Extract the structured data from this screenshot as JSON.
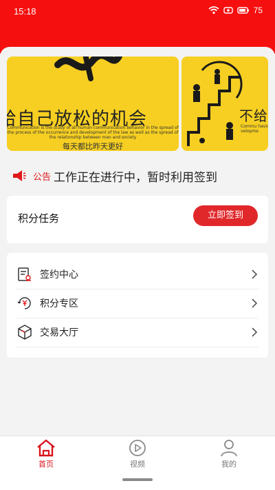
{
  "status_bar": {
    "time": "15:18",
    "battery": "75"
  },
  "banner": {
    "slide1": {
      "headline": "给自己放松的机会",
      "english": "Communication is the study of all human communication behavior in the spread of the process of the occurrence and development of the law as well as the spread of the relationship between man and society",
      "subline": "每天都比昨天更好"
    },
    "slide2": {
      "headline": "不给",
      "english": "Commu havior and velopme"
    }
  },
  "notice": {
    "tag": "公告",
    "text": "工作正在进行中，暂时利用签到"
  },
  "task": {
    "title": "积分任务",
    "button": "立即签到"
  },
  "menu": [
    {
      "label": "签约中心",
      "icon": "contract-icon"
    },
    {
      "label": "积分专区",
      "icon": "points-icon"
    },
    {
      "label": "交易大厅",
      "icon": "trade-box-icon"
    }
  ],
  "tabbar": {
    "tabs": [
      {
        "label": "首页",
        "icon": "home-icon",
        "active": true
      },
      {
        "label": "视频",
        "icon": "play-icon",
        "active": false
      },
      {
        "label": "我的",
        "icon": "user-icon",
        "active": false
      }
    ]
  },
  "colors": {
    "primary_red": "#f60f0f",
    "button_red": "#e0282b",
    "banner_yellow": "#f6cf22"
  }
}
